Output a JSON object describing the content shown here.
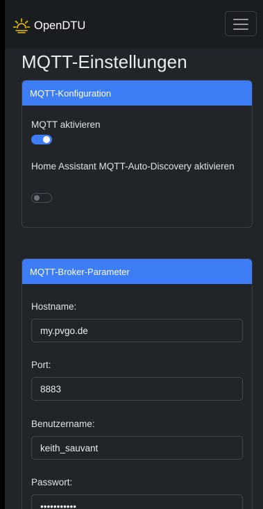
{
  "navbar": {
    "brand": "OpenDTU",
    "brand_icon": "sun-icon",
    "menu_icon": "hamburger-menu-icon"
  },
  "page": {
    "title": "MQTT-Einstellungen"
  },
  "mqtt_config": {
    "header": "MQTT-Konfiguration",
    "enable_label": "MQTT aktivieren",
    "enable_on": true,
    "hass_label": "Home Assistant MQTT-Auto-Discovery aktivieren",
    "hass_on": false
  },
  "broker": {
    "header": "MQTT-Broker-Parameter",
    "hostname_label": "Hostname:",
    "hostname_value": "my.pvgo.de",
    "port_label": "Port:",
    "port_value": "8883",
    "username_label": "Benutzername:",
    "username_value": "keith_sauvant",
    "password_label": "Passwort:",
    "password_value": "•••••••••••"
  },
  "colors": {
    "accent": "#3d7df6",
    "background": "#212529",
    "navbar": "#1a1d20",
    "brand_icon": "#f5c400"
  }
}
